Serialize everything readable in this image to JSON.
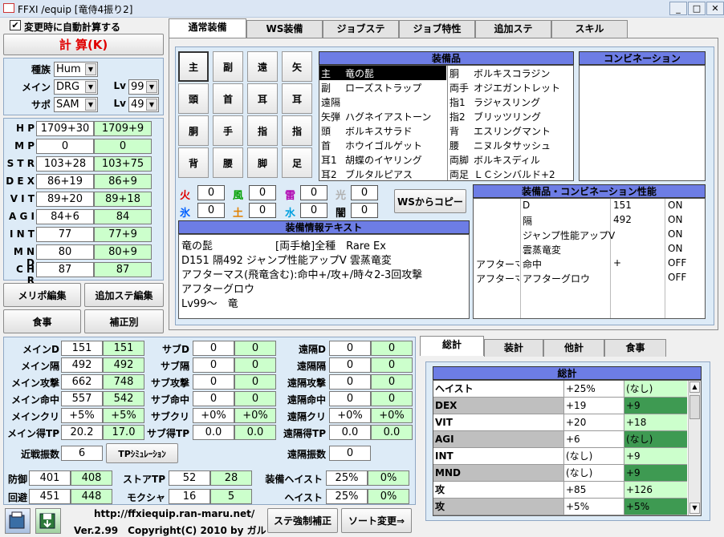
{
  "window": {
    "title": "FFXI /equip [竜侍4振り2]",
    "min": "_",
    "max": "□",
    "close": "✕"
  },
  "left": {
    "auto_label": "変更時に自動計算する",
    "calc": "計 算(K)",
    "race_label": "種族",
    "race": "Hum",
    "main_label": "メイン",
    "main_job": "DRG",
    "sub_label": "サポ",
    "sub_job": "SAM",
    "lv_label": "Lv",
    "main_lv": "99",
    "sub_lv": "49",
    "stats": [
      {
        "n": "H P",
        "a": "1709+30",
        "b": "1709+9"
      },
      {
        "n": "M P",
        "a": "0",
        "b": "0"
      },
      {
        "n": "S T R",
        "a": "103+28",
        "b": "103+75"
      },
      {
        "n": "D E X",
        "a": "86+19",
        "b": "86+9"
      },
      {
        "n": "V I T",
        "a": "89+20",
        "b": "89+18"
      },
      {
        "n": "A G I",
        "a": "84+6",
        "b": "84"
      },
      {
        "n": "I N T",
        "a": "77",
        "b": "77+9"
      },
      {
        "n": "M N D",
        "a": "80",
        "b": "80+9"
      },
      {
        "n": "C H R",
        "a": "87",
        "b": "87"
      }
    ],
    "btn1": "メリポ編集",
    "btn2": "追加ステ編集",
    "btn3": "食事",
    "btn4": "補正別"
  },
  "tabs": [
    "通常装備",
    "WS装備",
    "ジョブステ",
    "ジョブ特性",
    "追加ステ",
    "スキル"
  ],
  "slots": [
    "主",
    "副",
    "遠",
    "矢",
    "頭",
    "首",
    "耳",
    "耳",
    "胴",
    "手",
    "指",
    "指",
    "背",
    "腰",
    "脚",
    "足"
  ],
  "equip": {
    "header": "装備品",
    "left": [
      {
        "s": "主",
        "n": "竜の髭"
      },
      {
        "s": "副",
        "n": "ローズストラップ"
      },
      {
        "s": "遠隔",
        "n": ""
      },
      {
        "s": "矢弾",
        "n": "ハグネイアストーン"
      },
      {
        "s": "頭",
        "n": "ボルキスサラド"
      },
      {
        "s": "首",
        "n": "ホウイゴルゲット"
      },
      {
        "s": "耳1",
        "n": "胡蝶のイヤリング"
      },
      {
        "s": "耳2",
        "n": "ブルタルピアス"
      }
    ],
    "right": [
      {
        "s": "胴",
        "n": "ボルキスコラジン"
      },
      {
        "s": "両手",
        "n": "オジエガントレット"
      },
      {
        "s": "指1",
        "n": "ラジャスリング"
      },
      {
        "s": "指2",
        "n": "ブリッツリング"
      },
      {
        "s": "背",
        "n": "エスリングマント"
      },
      {
        "s": "腰",
        "n": "ニヌルタサッシュ"
      },
      {
        "s": "両脚",
        "n": "ボルキスディル"
      },
      {
        "s": "両足",
        "n": "ＬＣシンバルド+2"
      }
    ]
  },
  "combo_header": "コンビネーション",
  "elements": [
    {
      "n": "火",
      "c": "#e00000",
      "v": "0"
    },
    {
      "n": "風",
      "c": "#00a000",
      "v": "0"
    },
    {
      "n": "雷",
      "c": "#b000b0",
      "v": "0"
    },
    {
      "n": "光",
      "c": "#b0b0b0",
      "v": "0"
    },
    {
      "n": "氷",
      "c": "#0060ff",
      "v": "0"
    },
    {
      "n": "土",
      "c": "#e08000",
      "v": "0"
    },
    {
      "n": "水",
      "c": "#00a0e0",
      "v": "0"
    },
    {
      "n": "闇",
      "c": "#000000",
      "v": "0"
    }
  ],
  "ws_copy": "WSからコピー",
  "info": {
    "header": "装備情報テキスト",
    "lines": [
      "竜の髭　　　　　　[両手槍]全種　Rare Ex",
      "D151 隔492 ジャンプ性能アップV 雲蒸竜変",
      "アフターマス(飛竜含む):命中+/攻+/時々2-3回攻撃",
      "アフターグロウ",
      "Lv99～　竜"
    ]
  },
  "perf": {
    "header": "装備品・コンビネーション性能",
    "rows": [
      {
        "a": "",
        "b": "D",
        "c": "151",
        "d": "ON"
      },
      {
        "a": "",
        "b": "隔",
        "c": "492",
        "d": "ON"
      },
      {
        "a": "",
        "b": "ジャンプ性能アップV",
        "c": "",
        "d": "ON"
      },
      {
        "a": "",
        "b": "雲蒸竜変",
        "c": "",
        "d": "ON"
      },
      {
        "a": "アフターマ",
        "b": "命中",
        "c": "+",
        "d": "OFF"
      },
      {
        "a": "アフターマ",
        "b": "アフターグロウ",
        "c": "",
        "d": "OFF"
      }
    ]
  },
  "bottom": {
    "col1": [
      {
        "l": "メインD",
        "a": "151",
        "b": "151"
      },
      {
        "l": "メイン隔",
        "a": "492",
        "b": "492"
      },
      {
        "l": "メイン攻撃",
        "a": "662",
        "b": "748"
      },
      {
        "l": "メイン命中",
        "a": "557",
        "b": "542"
      },
      {
        "l": "メインクリ",
        "a": "+5%",
        "b": "+5%"
      },
      {
        "l": "メイン得TP",
        "a": "20.2",
        "b": "17.0"
      }
    ],
    "col2": [
      {
        "l": "サブD",
        "a": "0",
        "b": "0"
      },
      {
        "l": "サブ隔",
        "a": "0",
        "b": "0"
      },
      {
        "l": "サブ攻撃",
        "a": "0",
        "b": "0"
      },
      {
        "l": "サブ命中",
        "a": "0",
        "b": "0"
      },
      {
        "l": "サブクリ",
        "a": "+0%",
        "b": "+0%"
      },
      {
        "l": "サブ得TP",
        "a": "0.0",
        "b": "0.0"
      }
    ],
    "col3": [
      {
        "l": "遠隔D",
        "a": "0",
        "b": "0"
      },
      {
        "l": "遠隔隔",
        "a": "0",
        "b": "0"
      },
      {
        "l": "遠隔攻撃",
        "a": "0",
        "b": "0"
      },
      {
        "l": "遠隔命中",
        "a": "0",
        "b": "0"
      },
      {
        "l": "遠隔クリ",
        "a": "+0%",
        "b": "+0%"
      },
      {
        "l": "遠隔得TP",
        "a": "0.0",
        "b": "0.0"
      }
    ],
    "melee_hits_label": "近戦振数",
    "melee_hits": "6",
    "tpsim": "TPｼﾐｭﾚｰｼｮﾝ",
    "ranged_hits_label": "遠隔振数",
    "ranged_hits": "0",
    "def_label": "防御",
    "def_a": "401",
    "def_b": "408",
    "storetp_label": "ストアTP",
    "stp_a": "52",
    "stp_b": "28",
    "eqhaste_label": "装備ヘイスト",
    "eqh_a": "25%",
    "eqh_b": "0%",
    "eva_label": "回避",
    "eva_a": "451",
    "eva_b": "448",
    "mokusha_label": "モクシャ",
    "mok_a": "16",
    "mok_b": "5",
    "haste_label": "ヘイスト",
    "h_a": "25%",
    "h_b": "0%",
    "url": "http://ffxiequip.ran-maru.net/",
    "version": "Ver.2.99　Copyright(C) 2010 by ガル",
    "force": "ステ強制補正",
    "sort": "ソート変更⇒"
  },
  "sum": {
    "tabs": [
      "総計",
      "装計",
      "他計",
      "食事"
    ],
    "header": "総計",
    "rows": [
      {
        "n": "ヘイスト",
        "a": "+25%",
        "b": "(なし)"
      },
      {
        "n": "DEX",
        "a": "+19",
        "b": "+9"
      },
      {
        "n": "VIT",
        "a": "+20",
        "b": "+18"
      },
      {
        "n": "AGI",
        "a": "+6",
        "b": "(なし)"
      },
      {
        "n": "INT",
        "a": "(なし)",
        "b": "+9"
      },
      {
        "n": "MND",
        "a": "(なし)",
        "b": "+9"
      },
      {
        "n": "攻",
        "a": "+85",
        "b": "+126"
      },
      {
        "n": "攻",
        "a": "+5%",
        "b": "+5%"
      }
    ]
  }
}
